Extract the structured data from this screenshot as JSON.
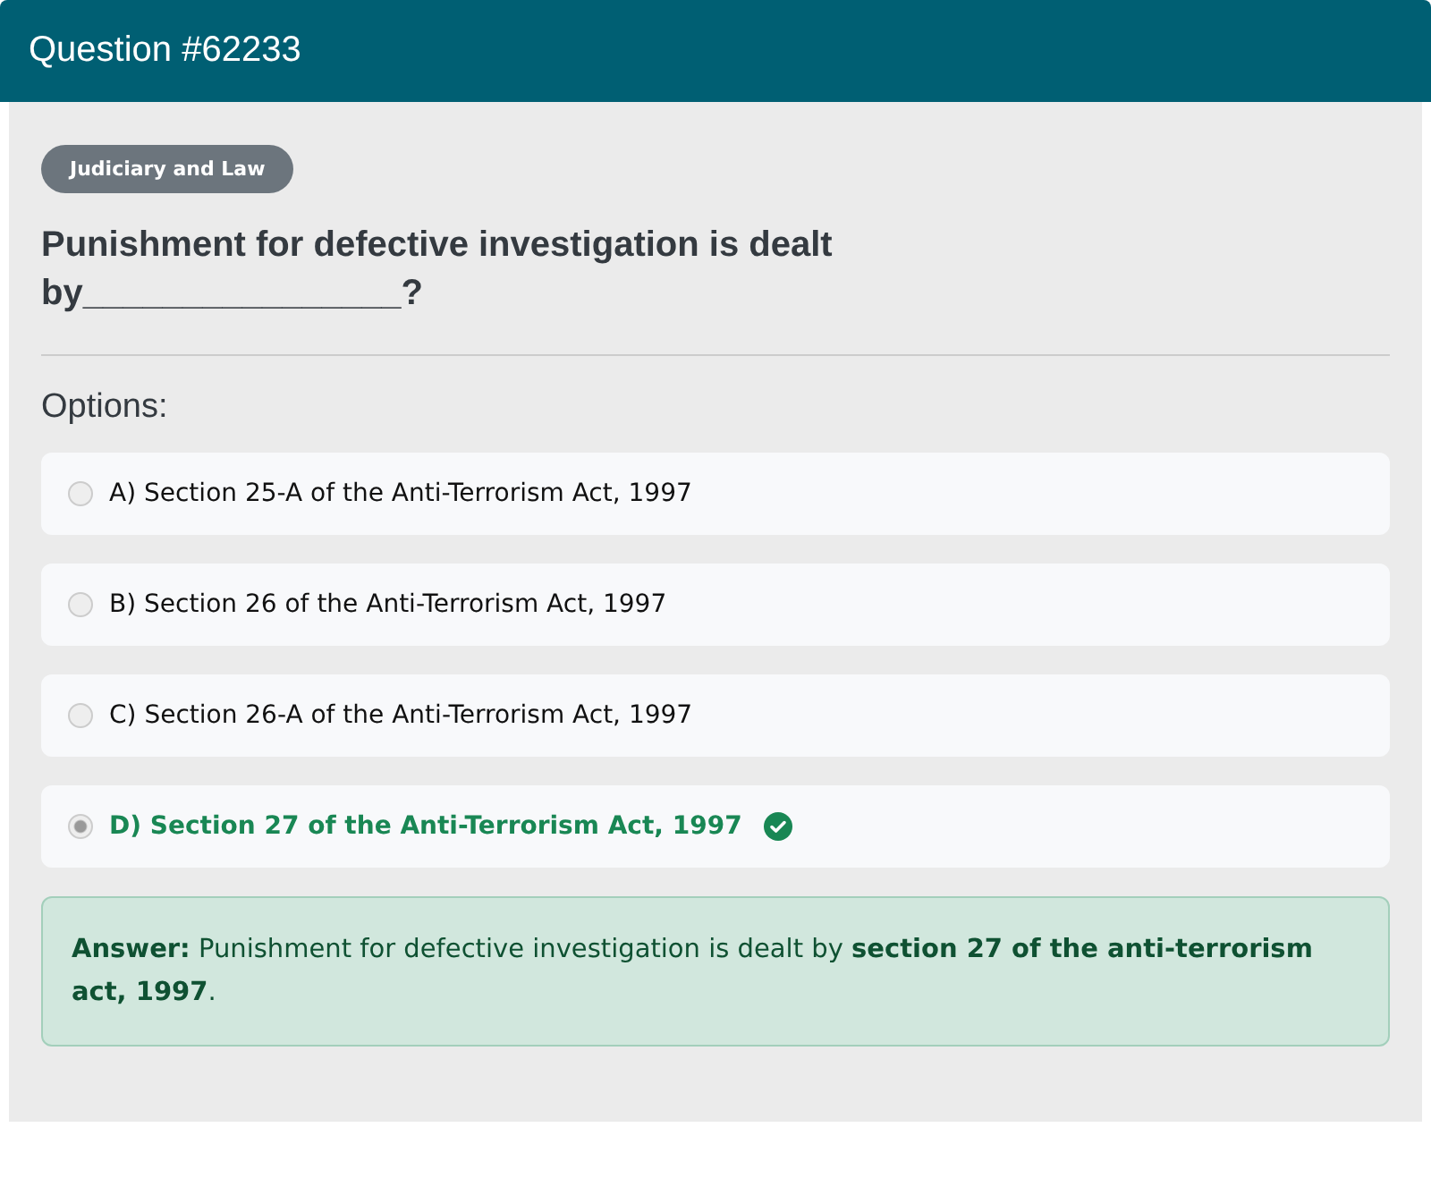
{
  "header": {
    "title": "Question #62233"
  },
  "category": "Judiciary and Law",
  "question": "Punishment for defective investigation is dealt by________________?",
  "options_label": "Options:",
  "options": [
    {
      "text": "A) Section 25-A of the Anti-Terrorism Act, 1997",
      "selected": false,
      "correct": false
    },
    {
      "text": "B) Section 26 of the Anti-Terrorism Act, 1997",
      "selected": false,
      "correct": false
    },
    {
      "text": "C) Section 26-A of the Anti-Terrorism Act, 1997",
      "selected": false,
      "correct": false
    },
    {
      "text": "D) Section 27 of the Anti-Terrorism Act, 1997",
      "selected": true,
      "correct": true
    }
  ],
  "answer": "**Answer:** Punishment for defective investigation is dealt by **section 27 of the anti-terrorism act, 1997**."
}
